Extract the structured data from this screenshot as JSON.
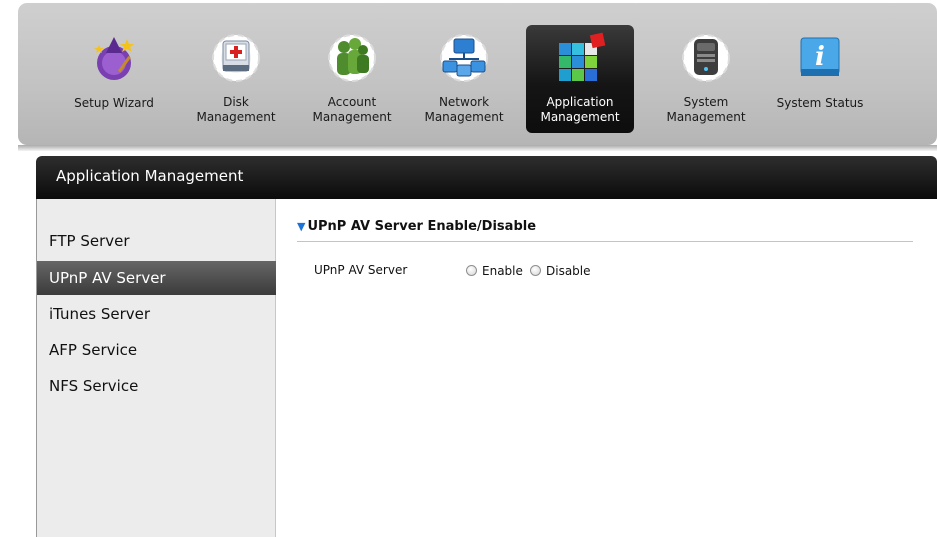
{
  "toolbar": {
    "items": [
      {
        "label": "Setup Wizard",
        "icon": "wizard-icon"
      },
      {
        "label": "Disk\nManagement",
        "icon": "disk-management-icon"
      },
      {
        "label": "Account\nManagement",
        "icon": "account-management-icon"
      },
      {
        "label": "Network\nManagement",
        "icon": "network-management-icon"
      },
      {
        "label": "Application\nManagement",
        "icon": "application-management-icon",
        "active": true
      },
      {
        "label": "System\nManagement",
        "icon": "system-management-icon"
      },
      {
        "label": "System Status",
        "icon": "info-icon"
      }
    ]
  },
  "panel": {
    "title": "Application Management"
  },
  "sidebar": {
    "items": [
      {
        "label": "FTP Server"
      },
      {
        "label": "UPnP AV Server",
        "active": true
      },
      {
        "label": "iTunes Server"
      },
      {
        "label": "AFP Service"
      },
      {
        "label": "NFS Service"
      }
    ]
  },
  "content": {
    "section_title": "UPnP AV Server Enable/Disable",
    "field_label": "UPnP AV Server",
    "options": {
      "enable": "Enable",
      "disable": "Disable"
    }
  },
  "colors": {
    "accent_arrow": "#1a73d6",
    "active_tab": "#151515",
    "toolbar_bg": "#c2c2c2"
  }
}
